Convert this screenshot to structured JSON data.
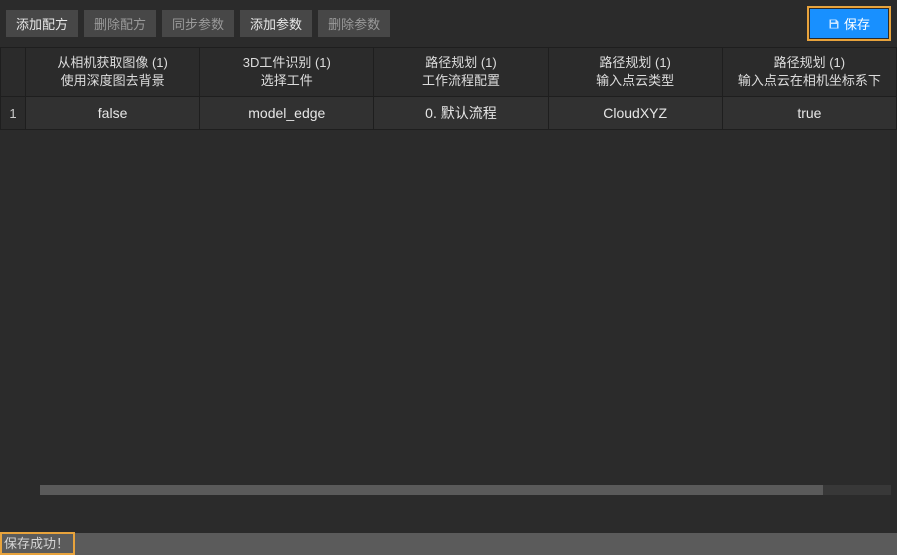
{
  "toolbar": {
    "add_recipe": "添加配方",
    "delete_recipe": "删除配方",
    "sync_params": "同步参数",
    "add_param": "添加参数",
    "delete_param": "删除参数",
    "save": "保存"
  },
  "columns": [
    {
      "line1": "从相机获取图像 (1)",
      "line2": "使用深度图去背景"
    },
    {
      "line1": "3D工件识别 (1)",
      "line2": "选择工件"
    },
    {
      "line1": "路径规划 (1)",
      "line2": "工作流程配置"
    },
    {
      "line1": "路径规划 (1)",
      "line2": "输入点云类型"
    },
    {
      "line1": "路径规划 (1)",
      "line2": "输入点云在相机坐标系下"
    }
  ],
  "rows": [
    {
      "num": "1",
      "cells": [
        "false",
        "model_edge",
        "0. 默认流程",
        "CloudXYZ",
        "true"
      ]
    }
  ],
  "status": "保存成功！"
}
